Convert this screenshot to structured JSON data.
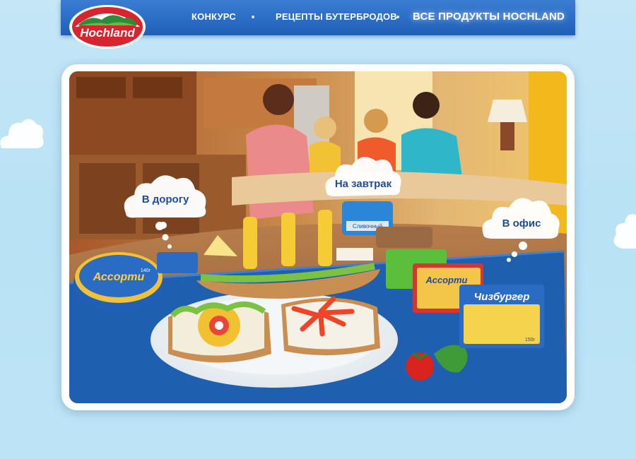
{
  "brand": {
    "logo_text": "Hochland"
  },
  "nav": {
    "items": [
      {
        "label": "КОНКУРС"
      },
      {
        "label": "РЕЦЕПТЫ БУТЕРБРОДОВ"
      },
      {
        "label": "ВСЕ ПРОДУКТЫ HOCHLAND"
      }
    ]
  },
  "bubbles": {
    "road": "В дорогу",
    "breakfast": "На завтрак",
    "office": "В офис"
  },
  "products": {
    "assorti_round": "Ассорти",
    "assorti_round_weight": "140г",
    "assorti_slices": "Ассорти",
    "cheeseburger": "Чизбургер",
    "cheeseburger_weight": "150г",
    "cream_label": "Сливочный"
  },
  "colors": {
    "header_blue": "#2a6cc4",
    "bubble_text": "#1c4d9a",
    "page_sky": "#bde4f6"
  }
}
